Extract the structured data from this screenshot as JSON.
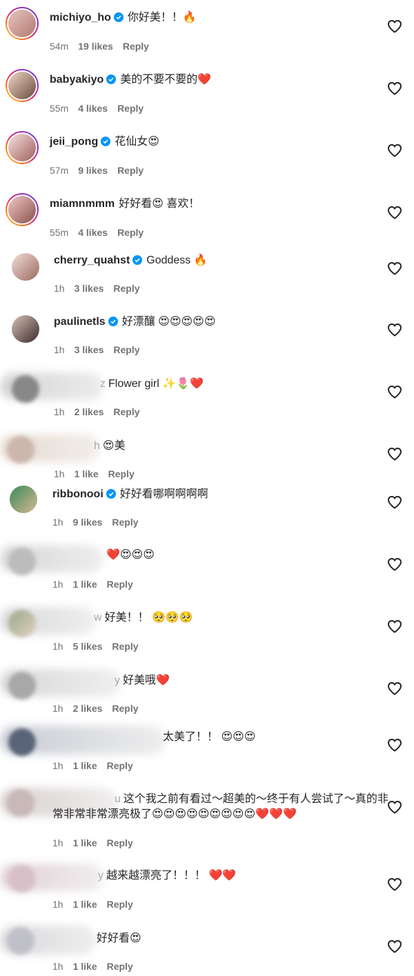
{
  "comments": [
    {
      "user": "michiyo_ho",
      "verified": true,
      "text": "你好美！！🔥",
      "time": "54m",
      "likes": "19 likes",
      "reply": "Reply"
    },
    {
      "user": "babyakiyo",
      "verified": true,
      "text": "美的不要不要的❤️",
      "time": "55m",
      "likes": "4 likes",
      "reply": "Reply"
    },
    {
      "user": "jeii_pong",
      "verified": true,
      "text": "花仙女😍",
      "time": "57m",
      "likes": "9 likes",
      "reply": "Reply"
    },
    {
      "user": "miamnmmm",
      "verified": false,
      "text": "好好看😍 喜欢！",
      "time": "55m",
      "likes": "4 likes",
      "reply": "Reply"
    },
    {
      "user": "cherry_quahst",
      "verified": true,
      "text": "Goddess 🔥",
      "time": "1h",
      "likes": "3 likes",
      "reply": "Reply"
    },
    {
      "user": "paulinetls",
      "verified": true,
      "text": "好漂釀 😍😍😍😍😍",
      "time": "1h",
      "likes": "3 likes",
      "reply": "Reply"
    },
    {
      "user": "z",
      "verified": false,
      "text": "Flower girl ✨🌷❤️",
      "time": "1h",
      "likes": "2 likes",
      "reply": "Reply"
    },
    {
      "user": "h",
      "verified": false,
      "text": "😍美",
      "time": "1h",
      "likes": "1 like",
      "reply": "Reply"
    },
    {
      "user": "ribbonooi",
      "verified": true,
      "text": "好好看哪啊啊啊啊",
      "time": "1h",
      "likes": "9 likes",
      "reply": "Reply"
    },
    {
      "user": "",
      "verified": false,
      "text": "❤️😍😍😍",
      "time": "1h",
      "likes": "1 like",
      "reply": "Reply"
    },
    {
      "user": "w",
      "verified": false,
      "text": "好美！！ 🥺🥺🥺",
      "time": "1h",
      "likes": "5 likes",
      "reply": "Reply"
    },
    {
      "user": "y",
      "verified": false,
      "text": "好美哦❤️",
      "time": "1h",
      "likes": "2 likes",
      "reply": "Reply"
    },
    {
      "user": "",
      "verified": false,
      "text": "太美了！！ 😍😍😍",
      "time": "1h",
      "likes": "1 like",
      "reply": "Reply"
    },
    {
      "user": "u",
      "verified": false,
      "text": "这个我之前有看过～超美的～终于有人尝试了～真的非常非常非常漂亮极了😍😍😍😍😍😍😍😍😍❤️❤️❤️",
      "time": "1h",
      "likes": "1 like",
      "reply": "Reply"
    },
    {
      "user": "y",
      "verified": false,
      "text": "越来越漂亮了！！！ ❤️❤️",
      "time": "1h",
      "likes": "1 like",
      "reply": "Reply"
    },
    {
      "user": "",
      "verified": false,
      "text": "好好看😍",
      "time": "1h",
      "likes": "1 like",
      "reply": "Reply"
    }
  ],
  "icons": {
    "verified": "verified-badge-icon",
    "like": "heart-outline-icon"
  },
  "colors": {
    "verified": "#0095f6",
    "meta": "#737373"
  }
}
